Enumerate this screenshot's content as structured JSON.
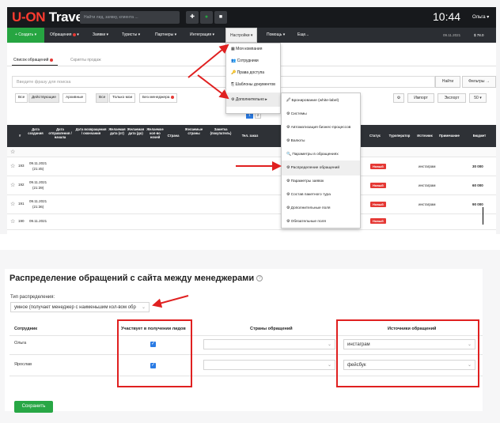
{
  "top_screen": {
    "logo": {
      "u": "U-ON",
      "travel": "Travel"
    },
    "search_placeholder": "Найти лид, заявку, клиента ...",
    "toolbar_icons": [
      "plus-icon",
      "dot-icon",
      "bookmark-icon"
    ],
    "clock": "10:44",
    "user": "Ольга ▾",
    "menu": {
      "create": "+ Создать ▾",
      "items": [
        "Обращения",
        "Заявки ▾",
        "Туристы ▾",
        "Партнеры ▾",
        "Интеграция ▾",
        "Настройки ▾",
        "Помощь ▾",
        "Еще..."
      ],
      "date": "09.11.2021",
      "currency": "$ 78.0"
    },
    "tabs": [
      "Список обращений",
      "Скрипты продаж"
    ],
    "search_placeholder_main": "Введите фразу для поиска",
    "find_button": "Найти",
    "filters_button": "Фильтры →",
    "segments": [
      "Все",
      "Действующие",
      "Архивные",
      "Все",
      "Только мои",
      "Без менеджера"
    ],
    "right_buttons": [
      "⚙",
      "Импорт",
      "Экспорт",
      "50 ▾"
    ],
    "pages": [
      "1",
      "2"
    ],
    "columns": [
      "#",
      "Дата создания",
      "Дата отправления / начала",
      "Дата возвращения / окончания",
      "Желаемая дата (от)",
      "Желаемая дата (до)",
      "Желаемое кол-во ночей",
      "Страна",
      "Желаемые страны",
      "Заметка (покупатель)",
      "Тел. заказ",
      "Статус",
      "Туроператор",
      "Источник",
      "Примечание",
      "Бюджет"
    ],
    "rows": [
      {
        "num": "193",
        "date": "09.11.2021",
        "time": "(21:45)",
        "status": "Новый",
        "source": "инстаграм",
        "budget": "30 000"
      },
      {
        "num": "192",
        "date": "09.11.2021",
        "time": "(21:39)",
        "status": "Новый",
        "source": "инстаграм",
        "budget": "60 000"
      },
      {
        "num": "191",
        "date": "09.11.2021",
        "time": "(21:36)",
        "status": "Новый",
        "source": "инстаграм",
        "budget": "90 000"
      },
      {
        "num": "190",
        "date": "09.11.2021",
        "time": "",
        "status": "Новый",
        "source": "",
        "budget": ""
      }
    ],
    "settings_menu": [
      "Моя компания",
      "Сотрудники",
      "Права доступа",
      "Шаблоны документов",
      "Дополнительно ▸"
    ],
    "more_menu": [
      "Бронирование (white-label)",
      "Системы",
      "Автоматизация бизнес-процессов",
      "Валюты",
      "Параметры в обращениях",
      "Распределение обращений",
      "Параметры заявок",
      "Состав пакетного тура",
      "Дополнительные поля",
      "Обязательные поля"
    ]
  },
  "bottom_screen": {
    "title": "Распределение обращений с сайта между менеджерами",
    "help": "?",
    "type_label": "Тип распределения:",
    "type_value": "умное (получает менеджер с наименьшим кол-вом обр",
    "columns": [
      "Сотрудник",
      "Участвует в получении лидов",
      "Страны обращений",
      "Источники обращений"
    ],
    "rows": [
      {
        "employee": "Ольга",
        "checked": "✓",
        "countries": "",
        "sources": "инстаграм"
      },
      {
        "employee": "Ярослав",
        "checked": "✓",
        "countries": "",
        "sources": "фейсбук"
      }
    ],
    "save_button": "Сохранить"
  },
  "colors": {
    "accent_red": "#e02020",
    "brand_green": "#26a541",
    "badge_red": "#e53935",
    "blue": "#2a7be4"
  }
}
